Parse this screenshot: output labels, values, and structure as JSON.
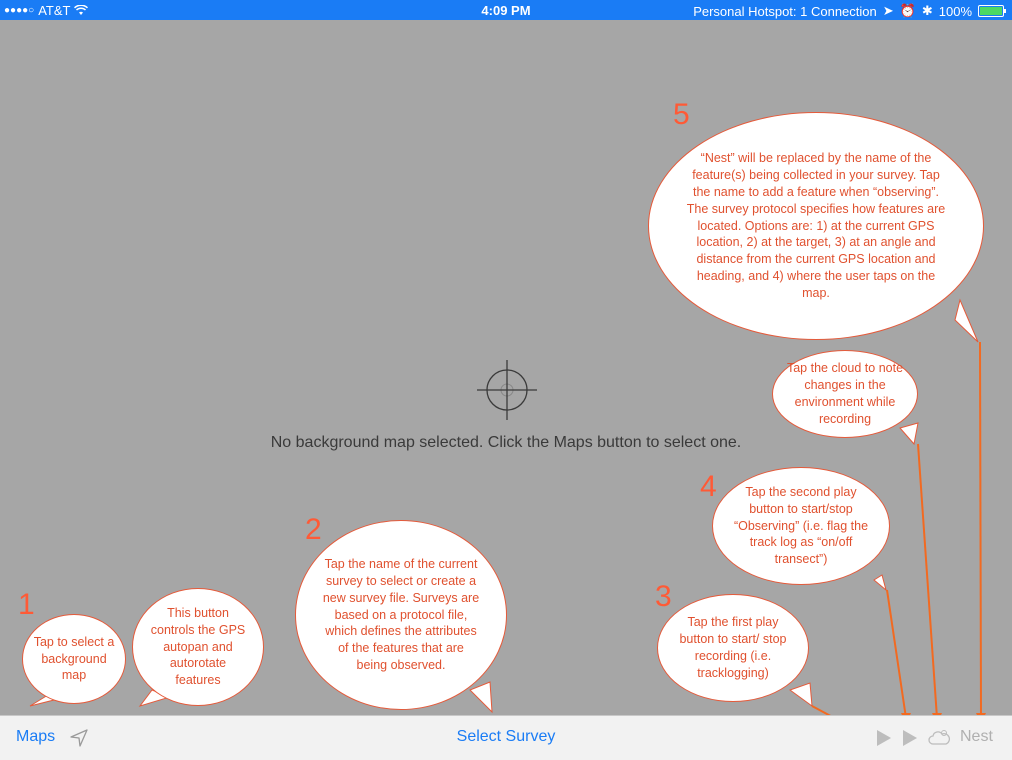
{
  "status": {
    "signal": "●●●●○",
    "carrier": "AT&T",
    "time": "4:09 PM",
    "hotspot": "Personal Hotspot: 1 Connection",
    "battery": "100%"
  },
  "map": {
    "message": "No background map selected. Click the Maps button to select one."
  },
  "toolbar": {
    "maps": "Maps",
    "select_survey": "Select Survey",
    "nest": "Nest"
  },
  "callouts": [
    {
      "number": "1",
      "text": "Tap to select a background map"
    },
    {
      "number": "",
      "text": "This button controls the GPS autopan and autorotate features"
    },
    {
      "number": "2",
      "text": "Tap the name of the current survey to select or create a new survey file. Surveys are based on a protocol file, which defines the attributes of the features that are being observed."
    },
    {
      "number": "3",
      "text": "Tap the first play button to start/ stop recording (i.e. tracklogging)"
    },
    {
      "number": "4",
      "text": "Tap the second play button to start/stop “Observing” (i.e. flag the track log as “on/off transect”)"
    },
    {
      "number": "",
      "text": "Tap the cloud to note changes in the environment while recording"
    },
    {
      "number": "5",
      "text": "“Nest” will be replaced by the name of the feature(s) being collected in your survey. Tap the name to add a feature when “observing”. The survey protocol specifies how features are located. Options are: 1) at the current GPS location, 2) at the target, 3) at an angle and distance from the current GPS location and heading, and 4) where the user taps on the map."
    }
  ],
  "colors": {
    "accent": "#1a7cf5",
    "callout": "#e0512f",
    "map_bg": "#a6a6a6"
  }
}
